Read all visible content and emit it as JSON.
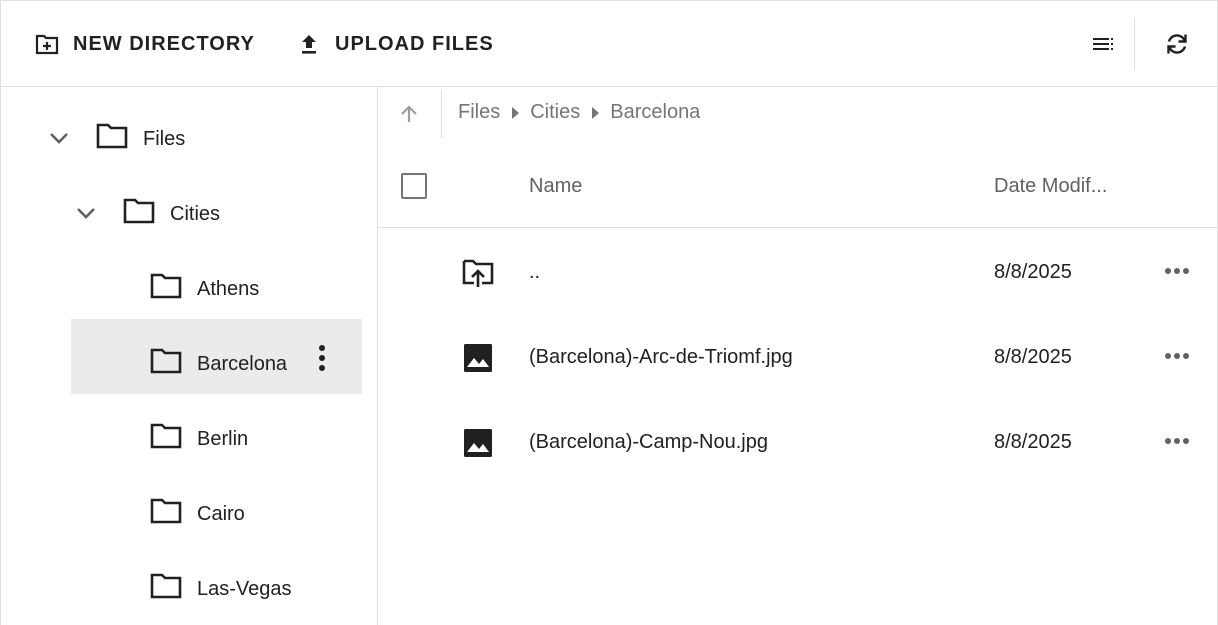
{
  "toolbar": {
    "new_directory_label": "NEW DIRECTORY",
    "upload_files_label": "UPLOAD FILES",
    "view_toggle_icon": "list-view-icon",
    "refresh_icon": "refresh-icon"
  },
  "tree": {
    "root": {
      "label": "Files",
      "expanded": true
    },
    "cities": {
      "label": "Cities",
      "expanded": true
    },
    "children": [
      {
        "label": "Athens",
        "selected": false
      },
      {
        "label": "Barcelona",
        "selected": true
      },
      {
        "label": "Berlin",
        "selected": false
      },
      {
        "label": "Cairo",
        "selected": false
      },
      {
        "label": "Las-Vegas",
        "selected": false
      }
    ]
  },
  "breadcrumb": {
    "items": [
      "Files",
      "Cities",
      "Barcelona"
    ]
  },
  "table": {
    "columns": {
      "name": "Name",
      "date": "Date Modif..."
    },
    "rows": [
      {
        "icon": "parent-folder-icon",
        "name": "..",
        "date": "8/8/2025"
      },
      {
        "icon": "image-icon",
        "name": "(Barcelona)-Arc-de-Triomf.jpg",
        "date": "8/8/2025"
      },
      {
        "icon": "image-icon",
        "name": "(Barcelona)-Camp-Nou.jpg",
        "date": "8/8/2025"
      }
    ]
  },
  "colors": {
    "text": "#212121",
    "muted": "#757575",
    "selected_bg": "#ebebeb",
    "border": "#e0e0e0"
  }
}
